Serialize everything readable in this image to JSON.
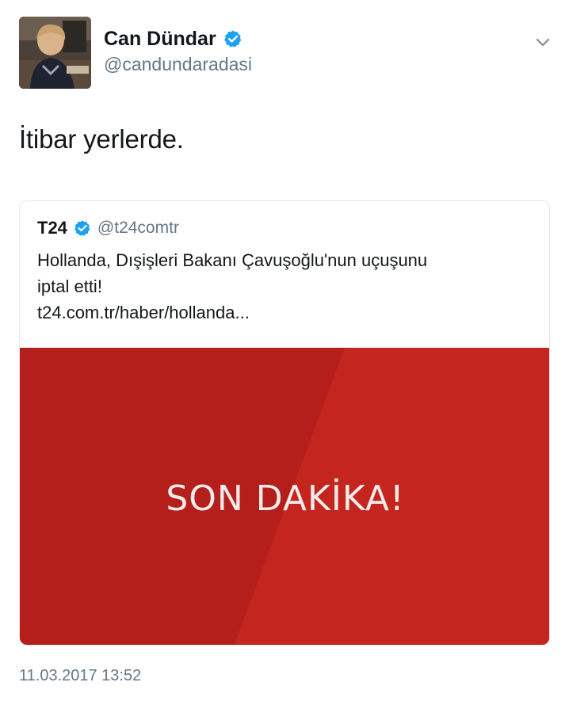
{
  "tweet": {
    "author_name": "Can Dündar",
    "author_handle": "@candundaradasi",
    "text": "İtibar yerlerde.",
    "timestamp": "11.03.2017 13:52",
    "menu_icon": "chevron-down-icon",
    "verified_icon": "verified-badge-icon"
  },
  "quote": {
    "name": "T24",
    "handle": "@t24comtr",
    "lines": [
      "Hollanda, Dışişleri Bakanı Çavuşoğlu'nun uçuşunu",
      "iptal etti!",
      "t24.com.tr/haber/hollanda..."
    ],
    "media_headline": "SON DAKİKA!"
  },
  "colors": {
    "verified_blue": "#1da1f2",
    "secondary_text": "#657786",
    "media_red": "#c0231f"
  }
}
